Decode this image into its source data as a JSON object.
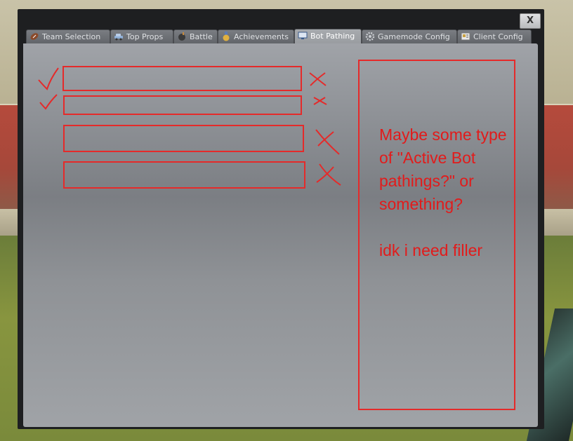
{
  "window": {
    "close_label": "X",
    "tabs": [
      {
        "label": "Team Selection",
        "icon": "football-icon",
        "active": false
      },
      {
        "label": "Top Props",
        "icon": "car-icon",
        "active": false
      },
      {
        "label": "Battle",
        "icon": "bomb-icon",
        "active": false
      },
      {
        "label": "Achievements",
        "icon": "medal-icon",
        "active": false
      },
      {
        "label": "Bot Pathing",
        "icon": "monitor-icon",
        "active": true
      },
      {
        "label": "Gamemode Config",
        "icon": "gear-icon",
        "active": false
      },
      {
        "label": "Client Config",
        "icon": "settings-card-icon",
        "active": false
      }
    ]
  },
  "mockup": {
    "note": "Maybe some type of \"Active Bot pathings?\" or something?\n\nidk i need filler",
    "annotation_color": "#e21b1b"
  }
}
